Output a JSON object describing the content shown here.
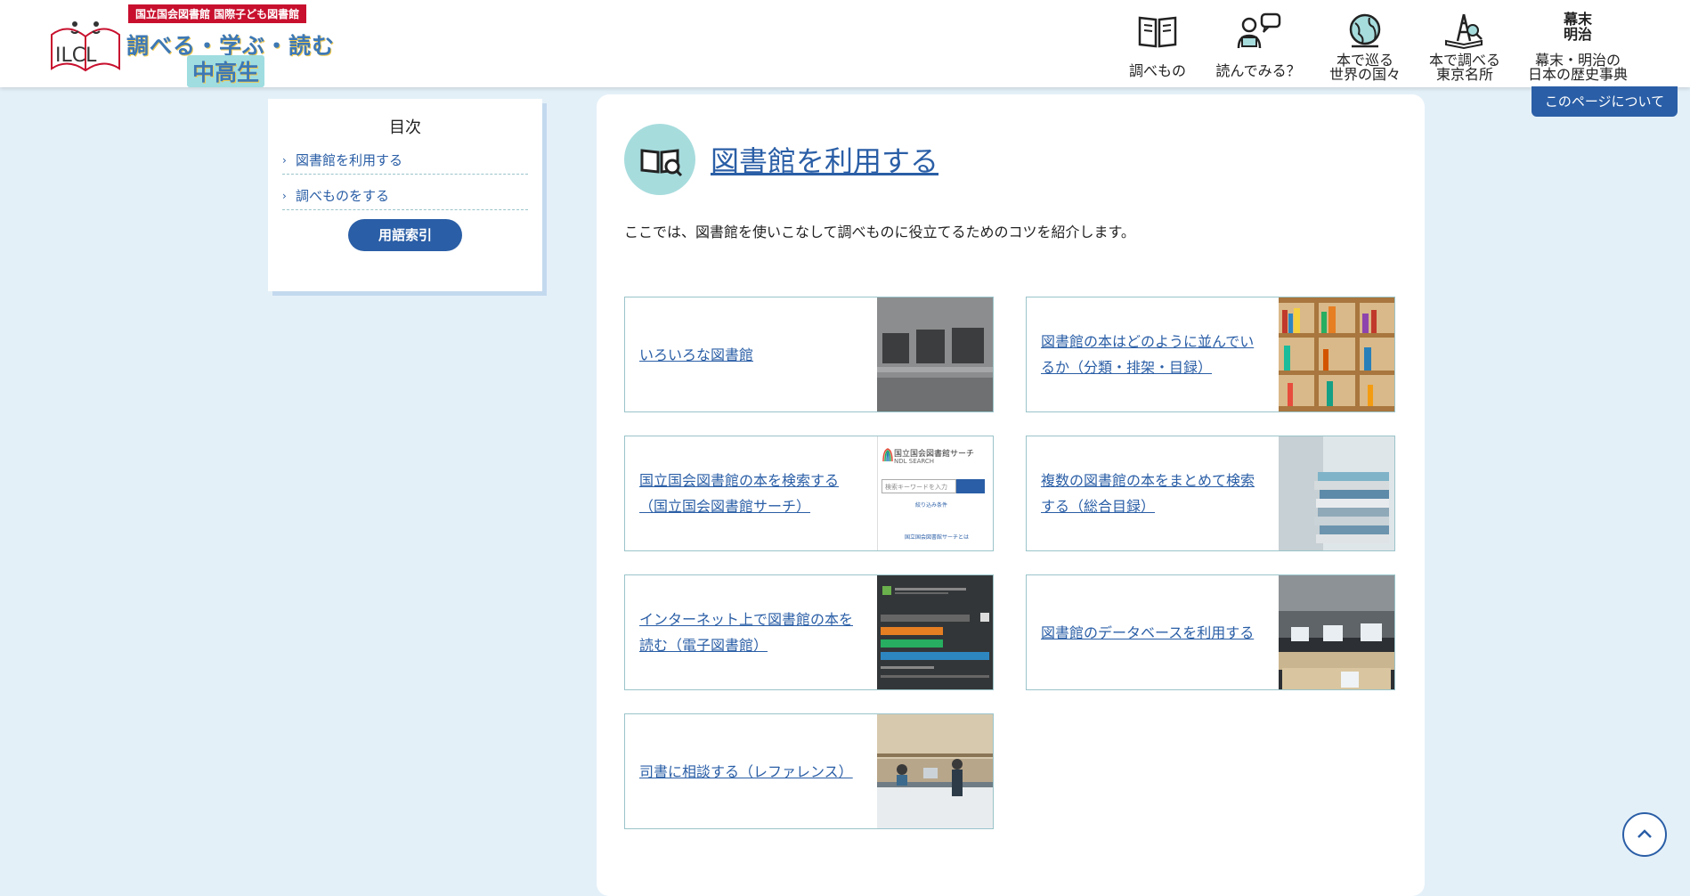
{
  "header": {
    "logo": {
      "badge": "国立国会図書館 国際子ども図書館",
      "emblem": "ILCL",
      "line1": "調べる・学ぶ・読む",
      "line2": "中高生"
    },
    "nav": [
      {
        "lines": [
          "調べもの"
        ],
        "icon": "book-icon"
      },
      {
        "lines": [
          "読んでみる？"
        ],
        "icon": "reader-chat-icon"
      },
      {
        "lines": [
          "本で巡る",
          "世界の国々"
        ],
        "icon": "globe-icon"
      },
      {
        "lines": [
          "本で調べる",
          "東京名所"
        ],
        "icon": "tokyo-tower-icon"
      },
      {
        "lines": [
          "幕末・明治の",
          "日本の歴史事典"
        ],
        "icon_text": "幕末\n明治",
        "icon": "bakumatsu-meiji-icon"
      }
    ]
  },
  "about_button": "このページについて",
  "toc": {
    "title": "目次",
    "items": [
      "図書館を利用する",
      "調べものをする"
    ],
    "glossary_button": "用語索引"
  },
  "main": {
    "title": "図書館を利用する",
    "intro": "ここでは、図書館を使いこなして調べものに役立てるためのコツを紹介します。",
    "cards": [
      {
        "label": "いろいろな図書館",
        "thumb": "library-building-sign-photo"
      },
      {
        "label": "図書館の本はどのように並んでいるか（分類・排架・目録）",
        "thumb": "bookshelf-photo"
      },
      {
        "label": "国立国会図書館の本を検索する（国立国会図書館サーチ）",
        "thumb": "ndl-search-screenshot",
        "thumb_texts": {
          "brand": "国立国会図書館サーチ",
          "brand_en": "NDL SEARCH",
          "placeholder": "検索キーワードを入力",
          "filter": "絞り込み条件",
          "about": "国立国会図書館サーチとは"
        }
      },
      {
        "label": "複数の図書館の本をまとめて検索する（総合目録）",
        "thumb": "book-stack-photo"
      },
      {
        "label": "インターネット上で図書館の本を読む（電子図書館）",
        "thumb": "digital-collections-screenshot"
      },
      {
        "label": "図書館のデータベースを利用する",
        "thumb": "computer-room-photo"
      },
      {
        "label": "司書に相談する（レファレンス）",
        "thumb": "reference-desk-photo"
      }
    ]
  },
  "colors": {
    "background": "#e4f0f8",
    "link": "#2a5ea6",
    "accent_teal": "#a7dcdd",
    "badge_red": "#c8102e"
  }
}
